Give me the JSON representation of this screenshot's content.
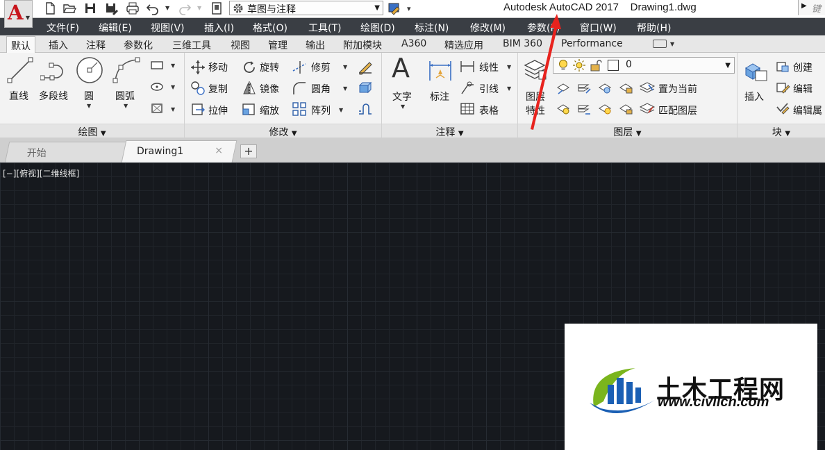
{
  "titlebar": {
    "app_letter": "A",
    "workspace": "草图与注释",
    "title": "Autodesk AutoCAD 2017    Drawing1.dwg",
    "search_hint": "键"
  },
  "menu": [
    "文件(F)",
    "编辑(E)",
    "视图(V)",
    "插入(I)",
    "格式(O)",
    "工具(T)",
    "绘图(D)",
    "标注(N)",
    "修改(M)",
    "参数(P)",
    "窗口(W)",
    "帮助(H)"
  ],
  "ribbon_tabs": [
    "默认",
    "插入",
    "注释",
    "参数化",
    "三维工具",
    "视图",
    "管理",
    "输出",
    "附加模块",
    "A360",
    "精选应用",
    "BIM 360",
    "Performance"
  ],
  "panels": {
    "draw": {
      "title": "绘图",
      "line": "直线",
      "polyline": "多段线",
      "circle": "圆",
      "arc": "圆弧"
    },
    "modify": {
      "title": "修改",
      "move": "移动",
      "rotate": "旋转",
      "trim": "修剪",
      "copy": "复制",
      "mirror": "镜像",
      "fillet": "圆角",
      "stretch": "拉伸",
      "scale": "缩放",
      "array": "阵列"
    },
    "annotation": {
      "title": "注释",
      "text": "文字",
      "dimension": "标注",
      "linear": "线性",
      "leader": "引线",
      "table": "表格"
    },
    "layers": {
      "title": "图层",
      "properties_1": "图层",
      "properties_2": "特性",
      "current_layer": "0",
      "set_current": "置为当前",
      "match_layer": "匹配图层"
    },
    "block": {
      "title": "块",
      "insert": "插入",
      "create": "创建",
      "edit": "编辑",
      "edit_attr": "编辑属"
    }
  },
  "doc_tabs": {
    "start": "开始",
    "drawing": "Drawing1",
    "close": "×",
    "new": "+"
  },
  "viewport_label": "[−][俯视][二维线框]",
  "watermark": {
    "name": "土木工程网",
    "url": "www.civilcn.com"
  },
  "colors": {
    "menu_bg": "#3a3e44",
    "canvas_bg": "#16191e",
    "app_red": "#c8161d",
    "arrow_red": "#e8231e",
    "logo_blue": "#1a5fb4",
    "logo_green": "#7ab51d"
  }
}
